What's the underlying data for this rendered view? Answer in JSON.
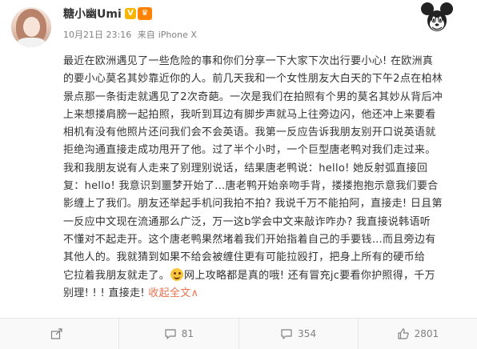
{
  "post": {
    "author": "糖小幽Umi",
    "verified_badge": "V",
    "date": "10月21日 23:16",
    "source_prefix": "来自",
    "source": "iPhone X",
    "lines": [
      "最近在欧洲遇见了一些危险的事和你们分享一下大家下次出行要小心! 在欧洲真",
      "的要小心莫名其妙靠近你的人。前几天我和一个女性朋友大白天的下午2点在柏林",
      "景点那一条街走就遇见了2次奇葩。一次是我们在拍照有个男的莫名其妙从背后冲",
      "上来想搂肩膀一起拍照，我听到耳边有脚步声就马上往旁边闪，他还冲上来要看",
      "相机有没有他照片还问我们会不会英语。我第一反应告诉我朋友别开口说英语就",
      "拒绝沟通直接走成功甩开了他。过了半个小时，一个巨型唐老鸭对我们走过来。",
      "我和我朋友说有人走来了别理别说话，结果唐老鸭说：hello! 她反射弧直接回",
      "复：hello! 我意识到噩梦开始了…唐老鸭开始亲吻手背，搂搂抱抱示意我们要合",
      "影缠上了我们。朋友还举起手机问我拍不拍? 我说千万不能拍阿，直接走! 日且第",
      "一反应中文现在流通那么广泛，万一这b学会中文来敲诈咋办? 我直接说韩语听",
      "不懂对不起走开。这个唐老鸭果然堵着我们开始指着自己的手要钱…而且旁边有",
      "其他人的。我就猜到如果不给会被缠住更有可能拉殴打，把身上所有的硬币给",
      "它拉着我朋友就走了。",
      "网上攻略都是真的哦! 还有冒充jc要看你护照得，千万",
      "别理! ! ! 直接走! "
    ],
    "collapse_link": "收起全文",
    "collapse_caret": "∧"
  },
  "actions": {
    "share_icon": "share-icon",
    "comment_count": "81",
    "comment_icon": "comment-icon",
    "repost_count": "354",
    "like_icon": "thumbs-up-icon",
    "like_count": "2801"
  },
  "colors": {
    "link": "#eb7350",
    "text": "#333333",
    "meta": "#808080",
    "badge": "#f7b500",
    "crown": "#ff8200"
  }
}
